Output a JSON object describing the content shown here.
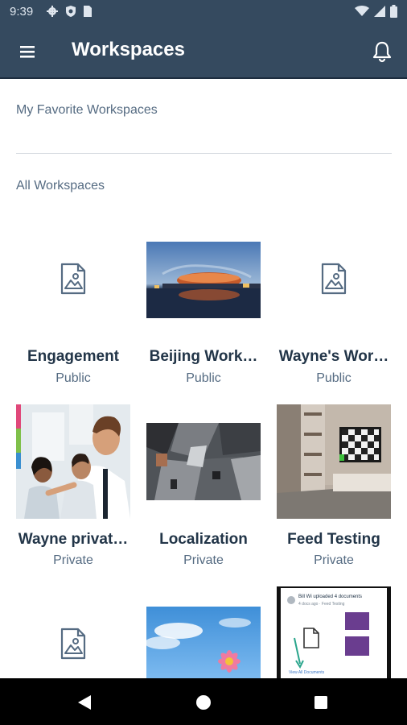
{
  "status_bar": {
    "time": "9:39",
    "icons": [
      "gear-icon",
      "shield-icon",
      "sim-card-icon",
      "wifi-icon",
      "signal-icon",
      "battery-icon"
    ]
  },
  "app_bar": {
    "title": "Workspaces",
    "menu_icon": "hamburger-menu-icon",
    "notification_icon": "bell-icon"
  },
  "sections": {
    "favorites": "My Favorite Workspaces",
    "all": "All Workspaces"
  },
  "workspaces": [
    {
      "name": "Engagement",
      "visibility": "Public",
      "thumbnail": "placeholder-image-icon"
    },
    {
      "name": "Beijing Work…",
      "visibility": "Public",
      "thumbnail": "stadium-night-photo"
    },
    {
      "name": "Wayne's Wor…",
      "visibility": "Public",
      "thumbnail": "placeholder-image-icon"
    },
    {
      "name": "Wayne privat…",
      "visibility": "Private",
      "thumbnail": "business-people-photo"
    },
    {
      "name": "Localization",
      "visibility": "Private",
      "thumbnail": "city-aerial-photo"
    },
    {
      "name": "Feed Testing",
      "visibility": "Private",
      "thumbnail": "room-tv-photo"
    },
    {
      "name": "",
      "visibility": "",
      "thumbnail": "placeholder-image-icon"
    },
    {
      "name": "",
      "visibility": "",
      "thumbnail": "flower-sky-photo"
    },
    {
      "name": "",
      "visibility": "",
      "thumbnail": "document-feed-screenshot"
    }
  ],
  "feed_preview": {
    "headline": "Bill Wi uploaded 4 documents",
    "subline": "4 docs ago · Feed Testing",
    "footer": "View All Documents"
  },
  "nav_bar": {
    "icons": [
      "back-icon",
      "home-icon",
      "recents-icon"
    ]
  },
  "colors": {
    "header": "#354a5f",
    "title_text": "#223548",
    "secondary_text": "#556b82",
    "divider": "#d9dde2"
  }
}
